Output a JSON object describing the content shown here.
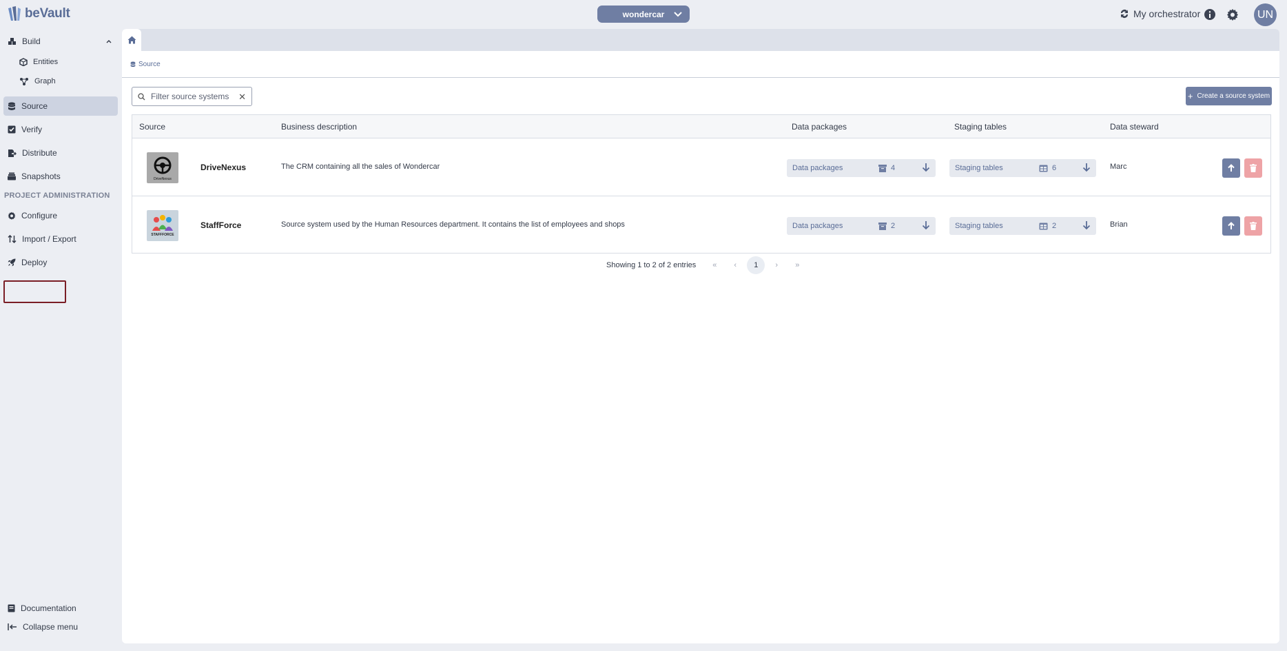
{
  "app": {
    "name": "beVault"
  },
  "header": {
    "project": "wondercar",
    "orchestrator_label": "My orchestrator",
    "avatar_initials": "UN"
  },
  "sidebar": {
    "build": "Build",
    "entities": "Entities",
    "graph": "Graph",
    "source": "Source",
    "verify": "Verify",
    "distribute": "Distribute",
    "snapshots": "Snapshots",
    "section_admin": "PROJECT ADMINISTRATION",
    "configure": "Configure",
    "import_export": "Import / Export",
    "deploy": "Deploy",
    "documentation": "Documentation",
    "collapse": "Collapse menu"
  },
  "breadcrumb": {
    "current": "Source"
  },
  "filter": {
    "placeholder": "Filter source systems"
  },
  "create_button": "Create a source system",
  "table": {
    "headers": {
      "source": "Source",
      "description": "Business description",
      "packages": "Data packages",
      "staging": "Staging tables",
      "steward": "Data steward"
    },
    "rows": [
      {
        "name": "DriveNexus",
        "description": "The CRM containing all the sales of Wondercar",
        "packages_label": "Data packages",
        "packages_count": "4",
        "staging_label": "Staging tables",
        "staging_count": "6",
        "steward": "Marc",
        "logo_text": "DriveNexus"
      },
      {
        "name": "StaffForce",
        "description": "Source system used by the Human Resources department. It contains the list of employees and shops",
        "packages_label": "Data packages",
        "packages_count": "2",
        "staging_label": "Staging tables",
        "staging_count": "2",
        "steward": "Brian",
        "logo_text": "STAFFFORCE"
      }
    ]
  },
  "pagination": {
    "info": "Showing 1 to 2 of 2 entries",
    "first": "«",
    "prev": "‹",
    "current": "1",
    "next": "›",
    "last": "»"
  },
  "colors": {
    "accent": "#6f7ea3",
    "danger": "#eea3a6",
    "highlight": "#7a1d25"
  }
}
